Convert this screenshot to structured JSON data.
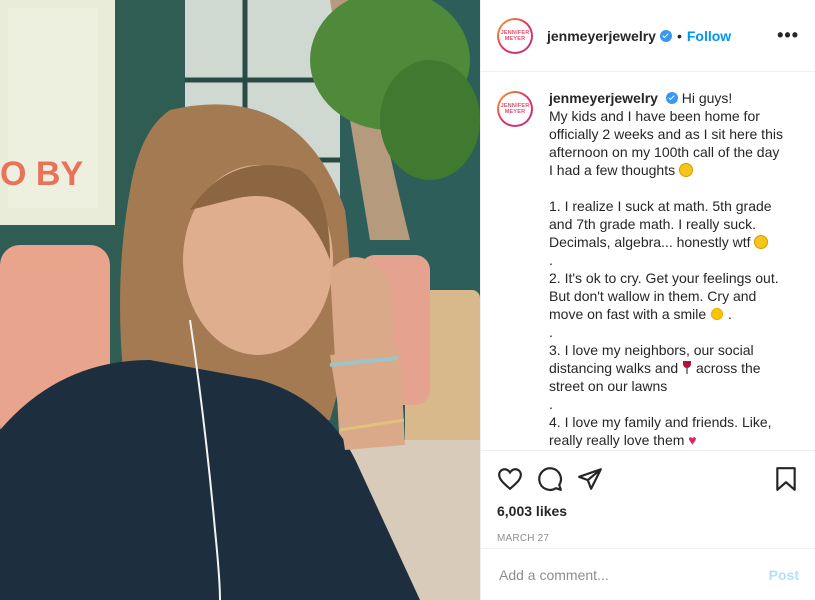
{
  "post": {
    "username": "jenmeyerjewelry",
    "avatar_text": "JENNIFER MEYER",
    "dot": "•",
    "follow_label": "Follow",
    "more_label": "•••",
    "caption_lines": [
      "Hi guys!",
      "My kids and I have been home for",
      "officially 2 weeks and as I sit here this",
      "afternoon on my 100th call of the day",
      "I had a few thoughts",
      "",
      "1. I realize I suck at math. 5th grade",
      "and 7th grade math. I really suck.",
      "Decimals, algebra... honestly wtf",
      ".",
      "2. It's ok to cry. Get your feelings out.",
      "But don't wallow in them. Cry and",
      "move on fast with a smile",
      ".",
      "3. I love my neighbors, our social",
      "distancing walks and",
      "street on our lawns",
      ".",
      "4. I love my family and friends. Like,",
      "really really love them"
    ],
    "caption_inline": {
      "walks_suffix": "across the",
      "smile_suffix": "."
    },
    "emojis": [
      "smiling-face",
      "laughing-face",
      "sun",
      "wine-glass",
      "heart"
    ],
    "likes": "6,003 likes",
    "date": "MARCH 27",
    "comment_placeholder": "Add a comment...",
    "post_label": "Post"
  },
  "colors": {
    "link_blue": "#0095f6",
    "post_disabled": "#b2dffc",
    "verified": "#3897f0"
  }
}
